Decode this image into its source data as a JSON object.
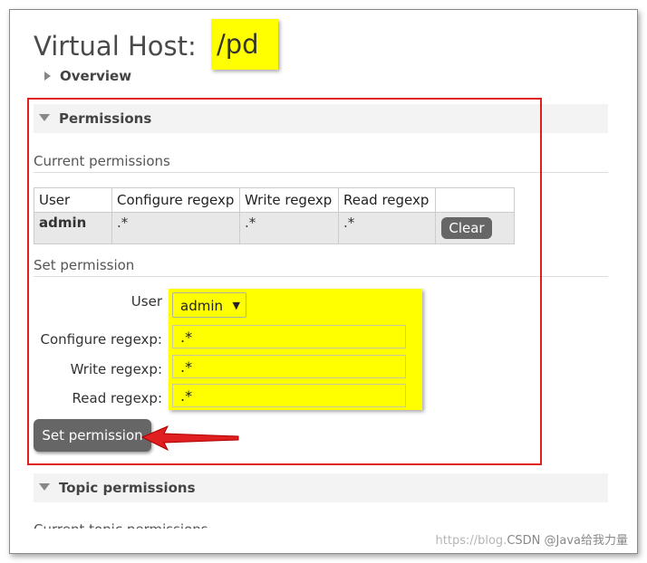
{
  "page": {
    "title_prefix": "Virtual Host:",
    "vhost_name": "/pd"
  },
  "sections": {
    "overview_label": "Overview",
    "permissions_label": "Permissions",
    "topic_permissions_label": "Topic permissions",
    "current_topic_permissions_label": "Current topic permissions"
  },
  "current_permissions": {
    "title": "Current permissions",
    "columns": [
      "User",
      "Configure regexp",
      "Write regexp",
      "Read regexp",
      ""
    ],
    "rows": [
      {
        "user": "admin",
        "configure": ".*",
        "write": ".*",
        "read": ".*",
        "action": "Clear"
      }
    ]
  },
  "set_permission": {
    "title": "Set permission",
    "user_label": "User",
    "user_value": "admin",
    "configure_label": "Configure regexp:",
    "configure_value": ".*",
    "write_label": "Write regexp:",
    "write_value": ".*",
    "read_label": "Read regexp:",
    "read_value": ".*",
    "submit_label": "Set permission"
  },
  "watermark": {
    "faint": "https://blog.",
    "main": "CSDN @Java给我力量"
  },
  "colors": {
    "highlight": "#ffff00",
    "annotation_red": "#e02020",
    "button_bg": "#666666"
  }
}
